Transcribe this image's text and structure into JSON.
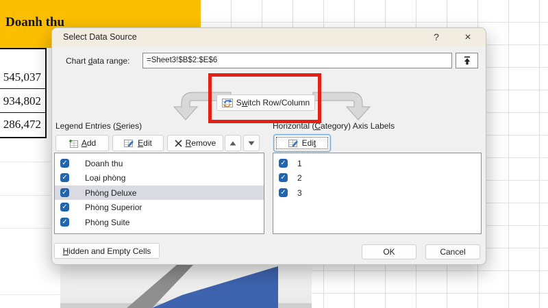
{
  "background": {
    "header_text": "Doanh thu",
    "column_values": [
      "545,037",
      "934,802",
      "286,472"
    ]
  },
  "dialog": {
    "title": "Select Data Source",
    "help_label": "?",
    "close_label": "×",
    "range_row": {
      "label_pre": "Chart ",
      "label_key": "d",
      "label_post": "ata range:",
      "value": "=Sheet3!$B$2:$E$6"
    },
    "switch_button": {
      "pre": "S",
      "key": "w",
      "post": "itch Row/Column"
    },
    "legend": {
      "label_pre": "Legend Entries (",
      "label_key": "S",
      "label_post": "eries)",
      "add": {
        "pre": "",
        "key": "A",
        "post": "dd"
      },
      "edit": {
        "pre": "",
        "key": "E",
        "post": "dit"
      },
      "remove": {
        "pre": "",
        "key": "R",
        "post": "emove"
      },
      "items": [
        "Doanh thu",
        "Loại phòng",
        "Phòng Deluxe",
        "Phòng Superior",
        "Phòng Suite"
      ],
      "selected_item": "Phòng Deluxe"
    },
    "axis": {
      "label_pre": "Horizontal (",
      "label_key": "C",
      "label_post": "ategory) Axis Labels",
      "edit": {
        "pre": "Edi",
        "key": "t",
        "post": ""
      },
      "items": [
        "1",
        "2",
        "3"
      ]
    },
    "footer": {
      "hidden_cells": {
        "pre": "",
        "key": "H",
        "post": "idden and Empty Cells"
      },
      "ok": "OK",
      "cancel": "Cancel"
    }
  },
  "colors": {
    "highlight_red": "#e32119",
    "checkbox_blue": "#2264ae",
    "sheet_yellow": "#fcbf00",
    "chart_blue": "#3e64b0",
    "chart_gray": "#8f8f8f",
    "titlebar_cream": "#f2ede1"
  }
}
